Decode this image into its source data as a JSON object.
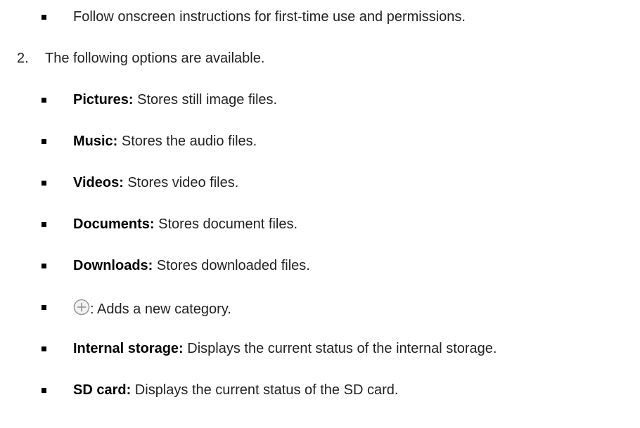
{
  "intro_item": {
    "text": "Follow onscreen instructions for first-time use and permissions."
  },
  "step2": {
    "number": "2.",
    "text": "The following options are available."
  },
  "options": [
    {
      "label": "Pictures:",
      "desc": " Stores still image files."
    },
    {
      "label": "Music:",
      "desc": " Stores the audio files."
    },
    {
      "label": "Videos:",
      "desc": " Stores video files."
    },
    {
      "label": "Documents:",
      "desc": " Stores document files."
    },
    {
      "label": "Downloads:",
      "desc": " Stores downloaded files."
    }
  ],
  "add_item": {
    "icon": "add-circle-icon",
    "desc": ": Adds a new category."
  },
  "storage_items": [
    {
      "label": "Internal storage:",
      "desc": " Displays the current status of the internal storage."
    },
    {
      "label": "SD card:",
      "desc": " Displays the current status of the SD card."
    }
  ],
  "colors": {
    "text": "#222222",
    "icon_stroke": "#9a9a9a",
    "icon_fill": "#f2f2f2"
  }
}
